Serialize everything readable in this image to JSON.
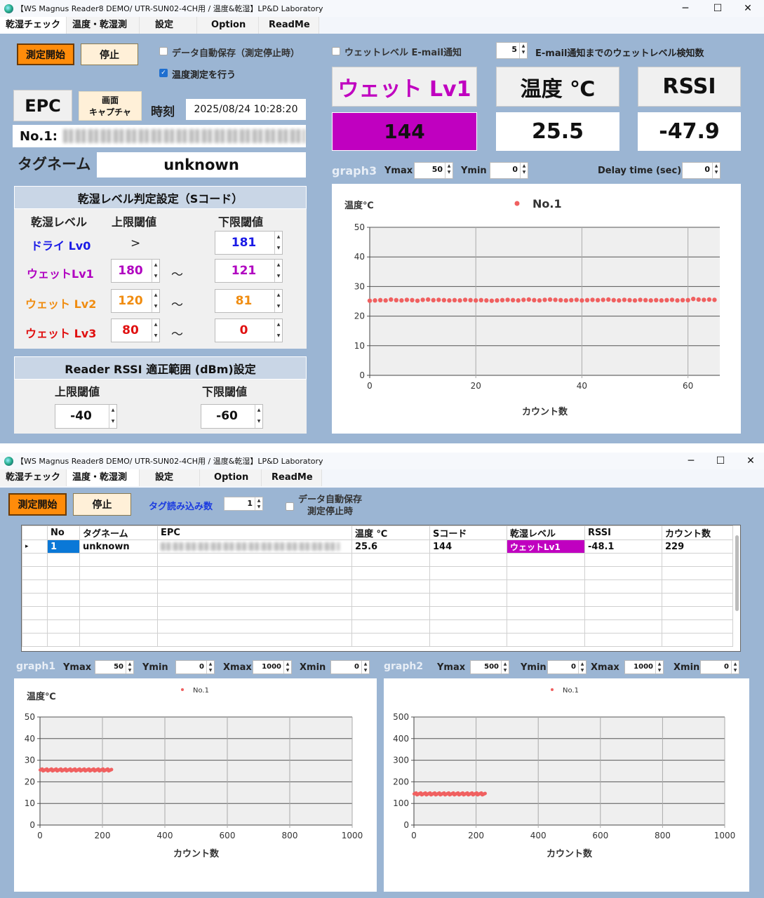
{
  "window1": {
    "title": "【WS Magnus Reader8 DEMO/ UTR-SUN02-4CH用 / 温度&乾湿】LP&D Laboratory",
    "tabs": [
      "乾湿チェック",
      "温度・乾湿測定",
      "設定",
      "Option",
      "ReadMe"
    ],
    "active_tab": "乾湿チェック",
    "start_button": "測定開始",
    "stop_button": "停止",
    "autosave_label": "データ自動保存（測定停止時）",
    "autosave_checked": false,
    "temp_measure_label": "温度測定を行う",
    "temp_measure_checked": true,
    "epc_button": "EPC",
    "capture_button_l1": "画面",
    "capture_button_l2": "キャプチャ",
    "time_label": "時刻",
    "time_value": "2025/08/24 10:28:20",
    "epc_prefix": "No.1:",
    "tagname_label": "タグネーム",
    "tagname_value": "unknown",
    "level_section": {
      "title": "乾湿レベル判定設定（Sコード）",
      "col_level": "乾湿レベル",
      "col_upper": "上限閾値",
      "col_lower": "下限閾値",
      "rows": [
        {
          "name": "ドライ Lv0",
          "upper": ">",
          "sep": "",
          "lower": "181",
          "color": "#1a1ae6"
        },
        {
          "name": "ウェットLv1",
          "upper": "180",
          "sep": "〜",
          "lower": "121",
          "color": "#b000c0"
        },
        {
          "name": "ウェット Lv2",
          "upper": "120",
          "sep": "〜",
          "lower": "81",
          "color": "#f08c10"
        },
        {
          "name": "ウェット Lv3",
          "upper": "80",
          "sep": "〜",
          "lower": "0",
          "color": "#e01010"
        }
      ]
    },
    "rssi_section": {
      "title": "Reader RSSI 適正範囲 (dBm)設定",
      "upper_label": "上限閾値",
      "lower_label": "下限閾値",
      "upper": "-40",
      "lower": "-60"
    },
    "email_label": "ウェットレベル E-mail通知",
    "email_checked": false,
    "email_count": "5",
    "email_count_label": "E-mail通知までのウェットレベル検知数",
    "level_title": "ウェット Lv1",
    "level_value": "144",
    "level_color": "#c000c0",
    "temp_title": "温度 ℃",
    "temp_value": "25.5",
    "rssi_title": "RSSI",
    "rssi_value": "-47.9",
    "graph3": {
      "label": "graph3",
      "ymax_label": "Ymax",
      "ymax": "50",
      "ymin_label": "Ymin",
      "ymin": "0",
      "delay_label": "Delay time (sec)",
      "delay": "0"
    }
  },
  "window2": {
    "title": "【WS Magnus Reader8 DEMO/ UTR-SUN02-4CH用 / 温度&乾湿】LP&D Laboratory",
    "tabs": [
      "乾湿チェック",
      "温度・乾湿測定",
      "設定",
      "Option",
      "ReadMe"
    ],
    "active_tab": "温度・乾湿測定",
    "start_button": "測定開始",
    "stop_button": "停止",
    "tag_count_label": "タグ読み込み数",
    "tag_count": "1",
    "autosave_l1": "データ自動保存",
    "autosave_l2": "測定停止時",
    "table": {
      "columns": [
        "No",
        "タグネーム",
        "EPC",
        "温度 ℃",
        "Sコード",
        "乾湿レベル",
        "RSSI",
        "カウント数"
      ],
      "rows": [
        {
          "no": "1",
          "tagname": "unknown",
          "temp": "25.6",
          "scode": "144",
          "level": "ウェットLv1",
          "rssi": "-48.1",
          "count": "229"
        }
      ]
    },
    "graph1": {
      "label": "graph1",
      "ymax": "50",
      "ymin": "0",
      "xmax": "1000",
      "xmin": "0"
    },
    "graph2": {
      "label": "graph2",
      "ymax": "500",
      "ymin": "0",
      "xmax": "1000",
      "xmin": "0"
    },
    "labels": {
      "ymax": "Ymax",
      "ymin": "Ymin",
      "xmax": "Xmax",
      "xmin": "Xmin"
    }
  },
  "chart_data": [
    {
      "id": "graph3",
      "type": "scatter",
      "ylabel": "温度℃",
      "xlabel": "カウント数",
      "legend": "No.1",
      "legend_pos": "top",
      "color": "#f06060",
      "xlim": [
        0,
        66
      ],
      "ylim": [
        0,
        50
      ],
      "xticks": [
        0,
        20,
        40,
        60
      ],
      "yticks": [
        0,
        10,
        20,
        30,
        40,
        50
      ],
      "y": [
        25.2,
        25.3,
        25.4,
        25.3,
        25.6,
        25.4,
        25.3,
        25.5,
        25.4,
        25.2,
        25.5,
        25.6,
        25.4,
        25.5,
        25.4,
        25.3,
        25.4,
        25.3,
        25.5,
        25.4,
        25.3,
        25.4,
        25.3,
        25.2,
        25.3,
        25.4,
        25.5,
        25.4,
        25.3,
        25.5,
        25.6,
        25.4,
        25.3,
        25.5,
        25.6,
        25.5,
        25.4,
        25.3,
        25.4,
        25.5,
        25.3,
        25.4,
        25.5,
        25.4,
        25.5,
        25.6,
        25.4,
        25.3,
        25.5,
        25.4,
        25.3,
        25.5,
        25.4,
        25.3,
        25.4,
        25.3,
        25.4,
        25.5,
        25.3,
        25.4,
        25.4,
        25.8,
        25.6,
        25.5,
        25.6,
        25.5
      ]
    },
    {
      "id": "graph1",
      "type": "scatter",
      "ylabel": "温度℃",
      "xlabel": "カウント数",
      "legend": "No.1",
      "legend_pos": "top",
      "color": "#f06060",
      "xlim": [
        0,
        1000
      ],
      "ylim": [
        0,
        50
      ],
      "xticks": [
        0,
        200,
        400,
        600,
        800,
        1000
      ],
      "yticks": [
        0,
        10,
        20,
        30,
        40,
        50
      ],
      "x_range": [
        1,
        229
      ],
      "y_level": 25.5
    },
    {
      "id": "graph2",
      "type": "scatter",
      "ylabel": "",
      "xlabel": "カウント数",
      "legend": "No.1",
      "legend_pos": "top",
      "color": "#f06060",
      "xlim": [
        0,
        1000
      ],
      "ylim": [
        0,
        500
      ],
      "xticks": [
        0,
        200,
        400,
        600,
        800,
        1000
      ],
      "yticks": [
        0,
        100,
        200,
        300,
        400,
        500
      ],
      "x_range": [
        1,
        229
      ],
      "y_level": 144
    }
  ]
}
